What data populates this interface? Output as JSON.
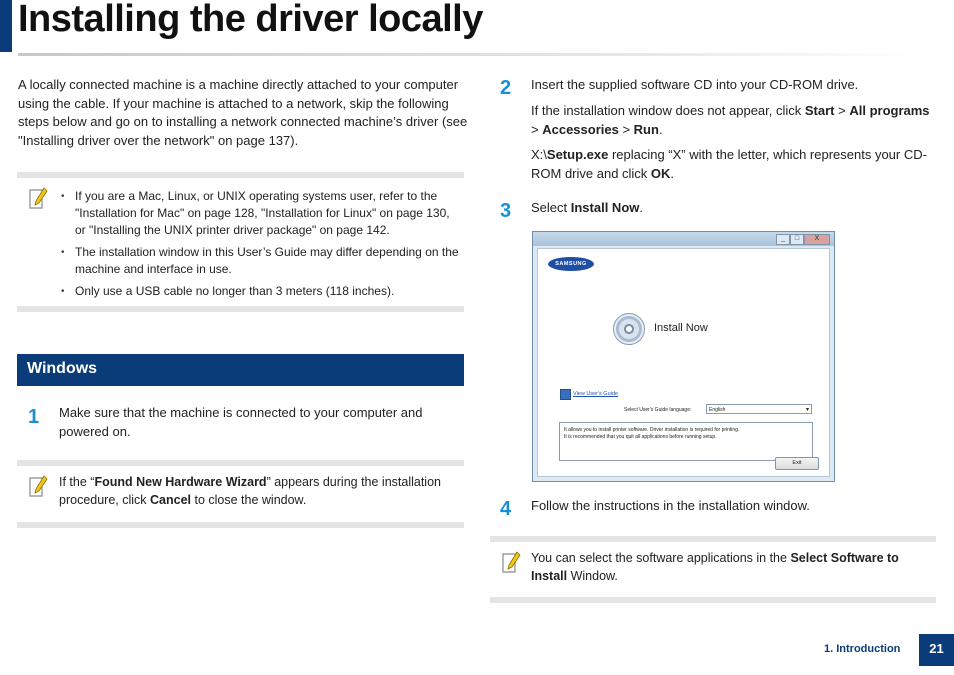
{
  "title": "Installing the driver locally",
  "intro": "A locally connected machine is a machine directly attached to your computer using the cable. If your machine is attached to a network, skip the following steps below and go on to installing a network connected machine’s driver (see \"Installing driver over the network\" on page 137).",
  "note1": {
    "items": [
      "If you are a Mac, Linux,  or UNIX operating systems user, refer to the \"Installation for Mac\" on page 128, \"Installation for Linux\" on page 130, or \"Installing the UNIX printer driver package\" on page 142.",
      "The installation window in this User’s Guide may differ depending on the machine and interface in use.",
      "Only use a USB cable no longer than 3 meters (118 inches)."
    ]
  },
  "section": "Windows",
  "step1": {
    "num": "1",
    "text": "Make sure that the machine is connected to your computer and powered on."
  },
  "note2": {
    "pre": "If the “",
    "bold1": "Found New Hardware Wizard",
    "mid": "” appears during the installation procedure, click ",
    "bold2": "Cancel",
    "post": " to close the window."
  },
  "step2": {
    "num": "2",
    "text": "Insert the supplied software CD into your CD-ROM drive.",
    "sub1_pre": "If the installation window does not appear, click ",
    "start": "Start",
    "gt1": " > ",
    "all_programs": "All programs",
    "gt2": " > ",
    "accessories": "Accessories",
    "gt3": " > ",
    "run": "Run",
    "dot": ".",
    "sub2_pre": " X:\\",
    "setup": "Setup.exe",
    "sub2_mid": " replacing “X” with the letter, which represents your CD-ROM drive and click ",
    "ok": "OK",
    "sub2_post": "."
  },
  "step3": {
    "num": "3",
    "pre": "Select ",
    "bold": "Install Now",
    "post": "."
  },
  "window": {
    "logo": "SAMSUNG",
    "install_now": "Install Now",
    "view_guide": "View User's Guide",
    "lang_label": "Select User's Guide language:",
    "lang_value": "English",
    "info_line1": "It allows you to install printer software. Driver installation is required for printing.",
    "info_line2": "It is recommended that you quit all applications before running setup.",
    "exit": "Exit",
    "btn_min": "_",
    "btn_max": "□",
    "btn_close": "X"
  },
  "step4": {
    "num": "4",
    "text": "Follow the instructions in the installation window."
  },
  "note3": {
    "pre": "You can select the software applications in the ",
    "bold": "Select Software to Install",
    "post": " Window."
  },
  "footer": {
    "label": "1. Introduction",
    "page": "21"
  }
}
